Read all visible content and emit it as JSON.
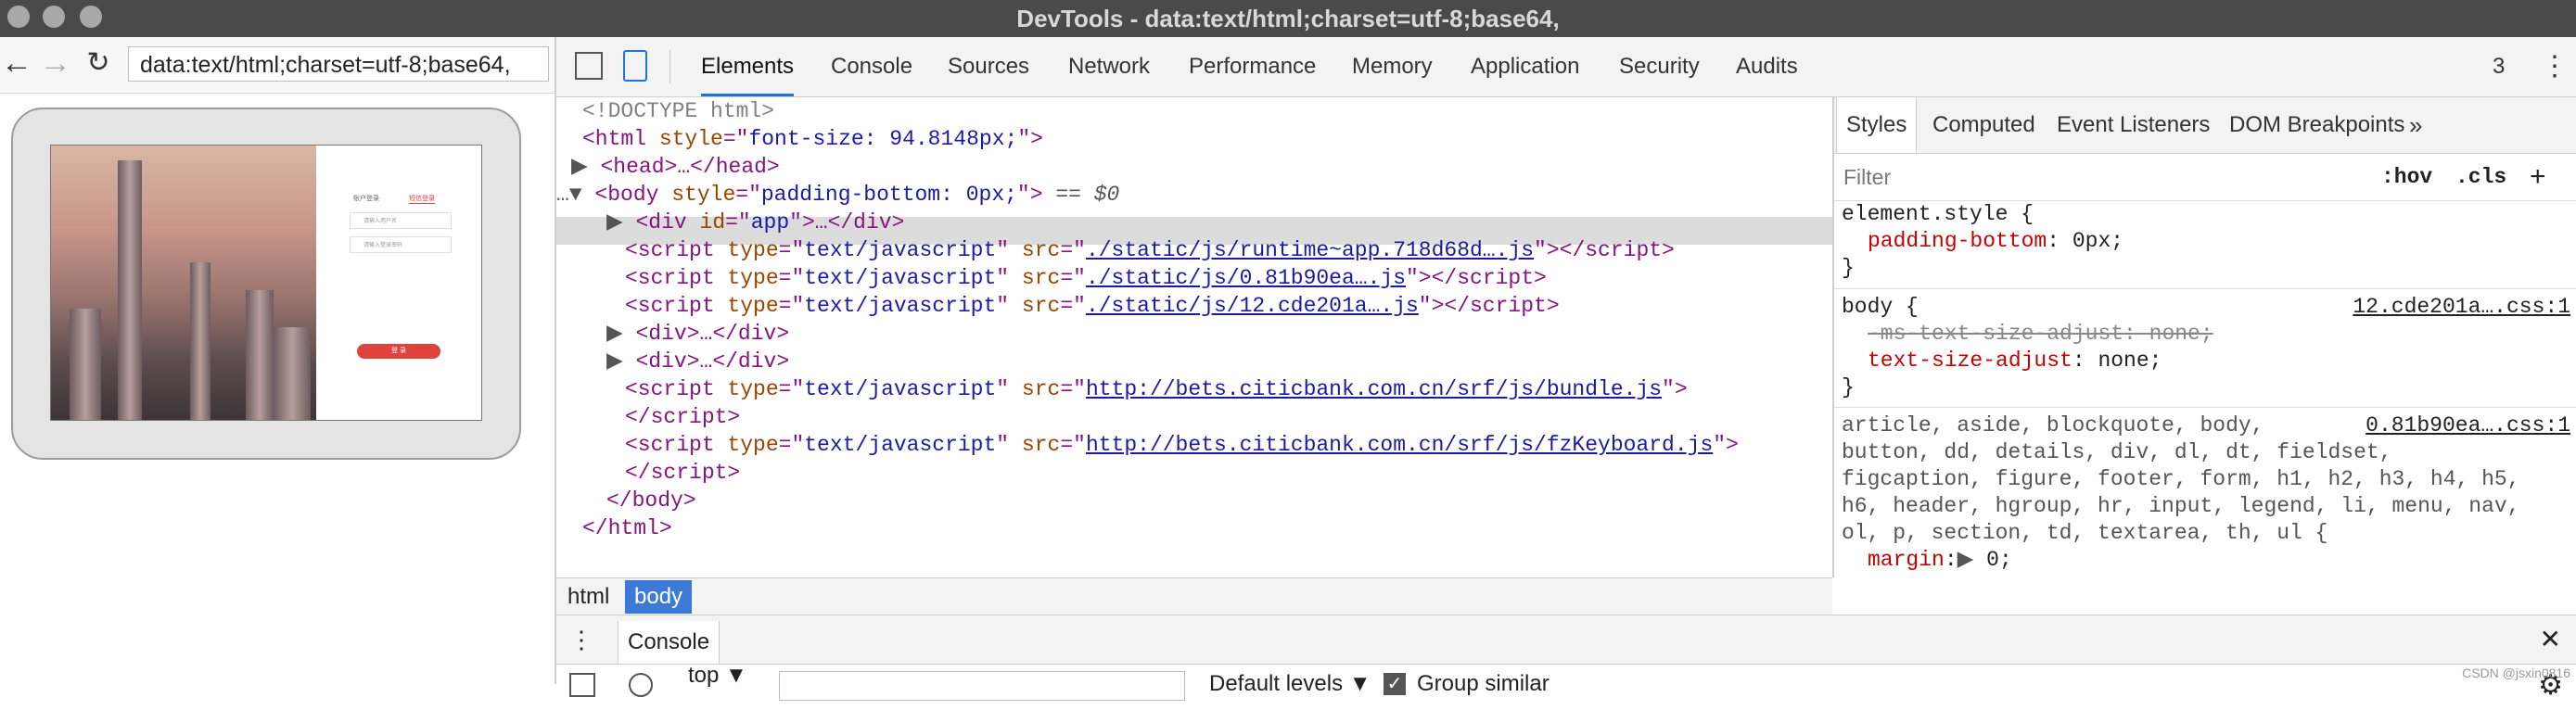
{
  "window": {
    "title": "DevTools - data:text/html;charset=utf-8;base64,"
  },
  "browser": {
    "url": "data:text/html;charset=utf-8;base64,"
  },
  "devtools": {
    "tabs": [
      "Elements",
      "Console",
      "Sources",
      "Network",
      "Performance",
      "Memory",
      "Application",
      "Security",
      "Audits"
    ],
    "active_tab": "Elements",
    "issue_count": "3"
  },
  "dom": {
    "doctype": "<!DOCTYPE html>",
    "html_open_style": "font-size: 94.8148px;",
    "head": "<head>…</head>",
    "body_style": "padding-bottom: 0px;",
    "dollar": "== $0",
    "div_app_id": "app",
    "scripts": [
      {
        "src": "./static/js/runtime~app.718d68d….js"
      },
      {
        "src": "./static/js/0.81b90ea….js"
      },
      {
        "src": "./static/js/12.cde201a….js"
      },
      {
        "src": "http://bets.citicbank.com.cn/srf/js/bundle.js"
      },
      {
        "src": "http://bets.citicbank.com.cn/srf/js/fzKeyboard.js"
      }
    ],
    "script_type": "text/javascript",
    "body_close": "</body>",
    "html_close": "</html>"
  },
  "breadcrumbs": [
    "html",
    "body"
  ],
  "styles": {
    "tabs": [
      "Styles",
      "Computed",
      "Event Listeners",
      "DOM Breakpoints"
    ],
    "filter_placeholder": "Filter",
    "hov": ":hov",
    "cls": ".cls",
    "rules": {
      "element_selector": "element.style {",
      "element_prop": "padding-bottom",
      "element_val": "0px;",
      "body_selector": "body {",
      "body_source": "12.cde201a….css:1",
      "body_prop1": "-ms-text-size-adjust: none;",
      "body_prop2": "text-size-adjust",
      "body_val2": "none;",
      "article_source": "0.81b90ea….css:1",
      "article_lines": [
        "article, aside, blockquote, body,",
        "button, dd, details, div, dl, dt, fieldset,",
        "figcaption, figure, footer, form, h1, h2, h3, h4, h5,",
        "h6, header, hgroup, hr, input, legend, li, menu, nav,",
        "ol, p, section, td, textarea, th, ul {"
      ],
      "margin_prop": "margin",
      "margin_val": "0;",
      "close_brace": "}"
    }
  },
  "console": {
    "tab": "Console",
    "context": "top",
    "levels": "Default levels",
    "group_similar": "Group similar",
    "group_similar_checked": true
  },
  "device_preview": {
    "tab1": "账户登录",
    "tab2": "短信登录",
    "field1": "请输入用户名",
    "field2": "请输入登录密码",
    "login": "登 录"
  },
  "watermark": "CSDN @jsxin0816"
}
